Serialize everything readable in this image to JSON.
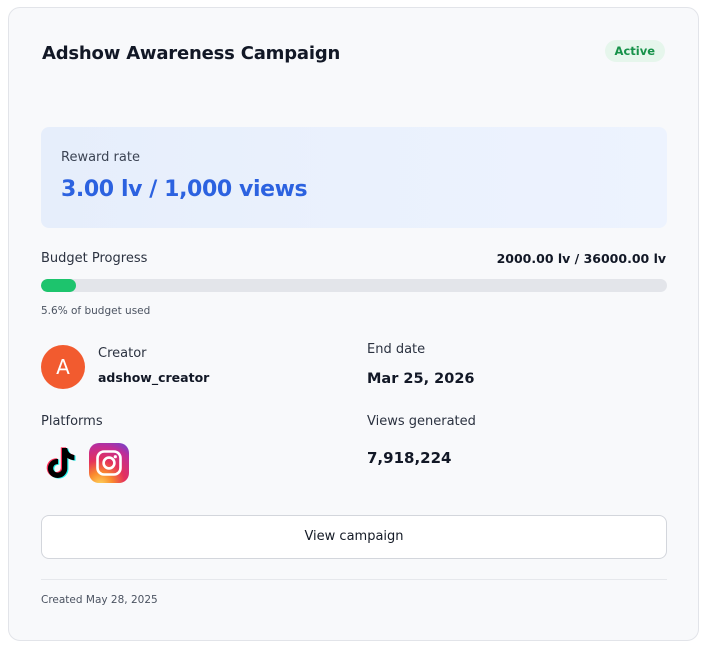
{
  "campaign": {
    "title": "Adshow Awareness Campaign",
    "status": "Active",
    "status_color": "#17924a"
  },
  "reward": {
    "label": "Reward rate",
    "value": "3.00 lv / 1,000 views",
    "accent_color": "#2c62e0"
  },
  "budget": {
    "label": "Budget Progress",
    "amount": "2000.00 lv / 36000.00 lv",
    "used_fraction": 0.056,
    "used_text": "5.6% of budget used",
    "bar_color": "#1dc46d"
  },
  "creator": {
    "label": "Creator",
    "name": "adshow_creator",
    "avatar_initial": "A",
    "avatar_color": "#f25b2f"
  },
  "end_date": {
    "label": "End date",
    "value": "Mar 25, 2026"
  },
  "platforms": {
    "label": "Platforms",
    "icons": [
      "tiktok-icon",
      "instagram-icon"
    ]
  },
  "views": {
    "label": "Views generated",
    "value": "7,918,224"
  },
  "actions": {
    "view_label": "View campaign"
  },
  "footer": {
    "created": "Created May 28, 2025"
  }
}
